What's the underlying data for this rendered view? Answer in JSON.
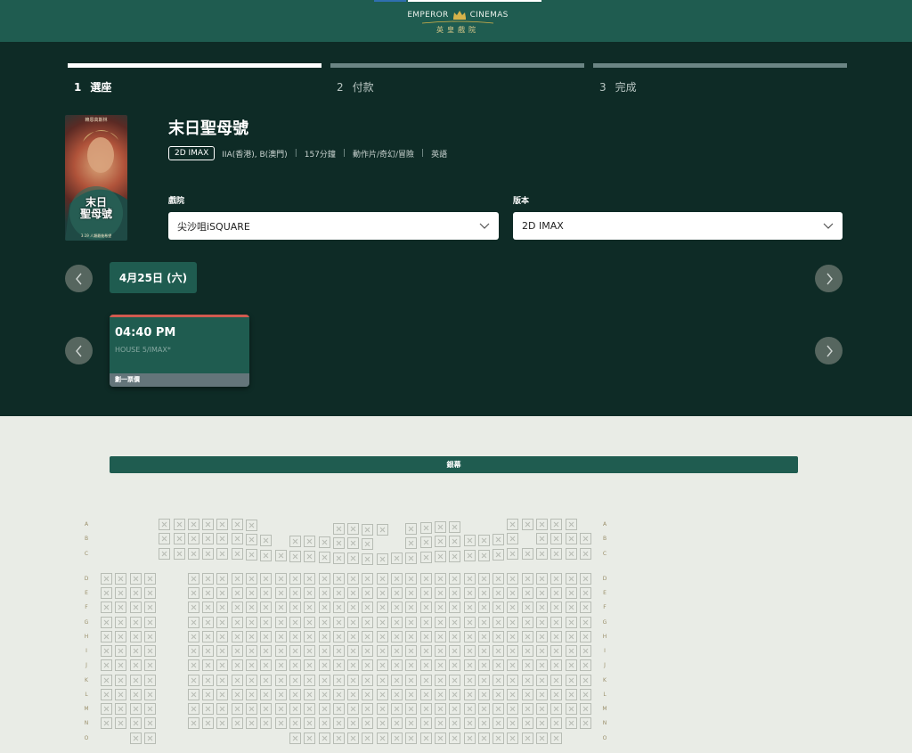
{
  "brand": {
    "name_en_left": "EMPEROR",
    "name_en_right": "CINEMAS",
    "name_zh": "英皇戲院"
  },
  "steps": [
    {
      "num": "1",
      "label": "選座",
      "active": true
    },
    {
      "num": "2",
      "label": "付款",
      "active": false
    },
    {
      "num": "3",
      "label": "完成",
      "active": false
    }
  ],
  "movie": {
    "title": "末日聖母號",
    "format_badge": "2D IMAX",
    "rating": "IIA(香港), B(澳門)",
    "duration": "157分鐘",
    "genre": "動作片/奇幻/冒險",
    "language": "英語",
    "poster": {
      "top_text": "賴恩高斯林",
      "main_text_line1": "末日",
      "main_text_line2": "聖母號",
      "bottom_text": "3.19 人類最後希望"
    }
  },
  "filters": {
    "cinema_label": "戲院",
    "cinema_value": "尖沙咀iSQUARE",
    "version_label": "版本",
    "version_value": "2D IMAX"
  },
  "date": {
    "selected": "4月25日 (六)"
  },
  "showtimes": [
    {
      "time": "04:40 PM",
      "house": "HOUSE 5/IMAX*",
      "price_note": "劃一票價"
    }
  ],
  "seatmap": {
    "screen_label": "銀幕",
    "rows": [
      "A",
      "B",
      "C",
      "D",
      "E",
      "F",
      "G",
      "H",
      "I",
      "J",
      "K",
      "L",
      "M",
      "N",
      "O"
    ],
    "all_unavailable": true
  },
  "colors": {
    "brand_green": "#1f5c50",
    "dark_bg": "#0e2b26",
    "light_bg": "#e9ece6",
    "accent_red": "#d05a4f"
  },
  "icons": {
    "prev": "chevron-left-icon",
    "next": "chevron-right-icon",
    "dropdown": "chevron-down-icon",
    "seat": "seat-unavailable-icon",
    "logo": "crown-icon"
  }
}
